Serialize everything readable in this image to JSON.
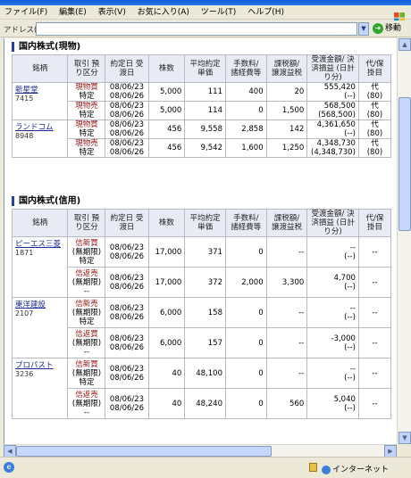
{
  "menu": [
    "ファイル(F)",
    "編集(E)",
    "表示(V)",
    "お気に入り(A)",
    "ツール(T)",
    "ヘルプ(H)"
  ],
  "address": {
    "label": "アドレス(D)",
    "go": "移動"
  },
  "headers": {
    "name": "銘柄",
    "acct": "取引 預り区分",
    "date": "約定日 受渡日",
    "qty": "株数",
    "avg": "平均約定 単価",
    "fee": "手数料/ 諸経費等",
    "tax": "課税額/ 譲渡益税",
    "total": "受渡金額/ 決済損益 (日計り分)",
    "pay": "代/保 掛目"
  },
  "sections": [
    {
      "title": "国内株式(現物)",
      "groups": [
        {
          "name": "新星堂",
          "code": "7415",
          "rows": [
            {
              "type": "現物買",
              "acct": "特定",
              "d1": "08/06/23",
              "d2": "08/06/26",
              "qty": "5,000",
              "avg": "111",
              "fee": "400",
              "tax": "20",
              "total": "555,420",
              "total2": "(--)",
              "pay": "代",
              "pay2": "(80)"
            },
            {
              "type": "現物売",
              "acct": "特定",
              "d1": "08/06/23",
              "d2": "08/06/26",
              "qty": "5,000",
              "avg": "114",
              "fee": "0",
              "tax": "1,500",
              "total": "568,500",
              "total2": "(568,500)",
              "pay": "代",
              "pay2": "(80)"
            }
          ]
        },
        {
          "name": "ランドコム",
          "code": "8948",
          "rows": [
            {
              "type": "現物買",
              "acct": "特定",
              "d1": "08/06/23",
              "d2": "08/06/26",
              "qty": "456",
              "avg": "9,558",
              "fee": "2,858",
              "tax": "142",
              "total": "4,361,650",
              "total2": "(--)",
              "pay": "代",
              "pay2": "(80)"
            },
            {
              "type": "現物売",
              "acct": "特定",
              "d1": "08/06/23",
              "d2": "08/06/26",
              "qty": "456",
              "avg": "9,542",
              "fee": "1,600",
              "tax": "1,250",
              "total": "4,348,730",
              "total2": "(4,348,730)",
              "pay": "代",
              "pay2": "(80)"
            }
          ]
        }
      ]
    },
    {
      "title": "国内株式(信用)",
      "groups": [
        {
          "name": "ピーエス三菱",
          "code": "1871",
          "rows": [
            {
              "type": "信新買",
              "acct": "(無期限) 特定",
              "d1": "08/06/23",
              "d2": "08/06/26",
              "qty": "17,000",
              "avg": "371",
              "fee": "0",
              "tax": "--",
              "total": "--",
              "total2": "(--)",
              "pay": "--",
              "pay2": ""
            },
            {
              "type": "信返売",
              "acct": "(無期限) --",
              "d1": "08/06/23",
              "d2": "08/06/26",
              "qty": "17,000",
              "avg": "372",
              "fee": "2,000",
              "tax": "3,300",
              "total": "4,700",
              "total2": "(--)",
              "pay": "--",
              "pay2": ""
            }
          ]
        },
        {
          "name": "東洋建設",
          "code": "2107",
          "rows": [
            {
              "type": "信新売",
              "acct": "(無期限) 特定",
              "d1": "08/06/23",
              "d2": "08/06/26",
              "qty": "6,000",
              "avg": "158",
              "fee": "0",
              "tax": "--",
              "total": "--",
              "total2": "(--)",
              "pay": "--",
              "pay2": ""
            },
            {
              "type": "信返買",
              "acct": "(無期限) --",
              "d1": "08/06/23",
              "d2": "08/06/26",
              "qty": "6,000",
              "avg": "157",
              "fee": "0",
              "tax": "--",
              "total": "-3,000",
              "total2": "(--)",
              "pay": "--",
              "pay2": ""
            }
          ]
        },
        {
          "name": "プロパスト",
          "code": "3236",
          "rows": [
            {
              "type": "信新買",
              "acct": "(無期限) 特定",
              "d1": "08/06/23",
              "d2": "08/06/26",
              "qty": "40",
              "avg": "48,100",
              "fee": "0",
              "tax": "--",
              "total": "--",
              "total2": "(--)",
              "pay": "--",
              "pay2": ""
            },
            {
              "type": "信返売",
              "acct": "(無期限) --",
              "d1": "08/06/23",
              "d2": "08/06/26",
              "qty": "40",
              "avg": "48,240",
              "fee": "0",
              "tax": "560",
              "total": "5,040",
              "total2": "(--)",
              "pay": "--",
              "pay2": ""
            }
          ]
        }
      ]
    }
  ],
  "status": {
    "zone": "インターネット"
  }
}
